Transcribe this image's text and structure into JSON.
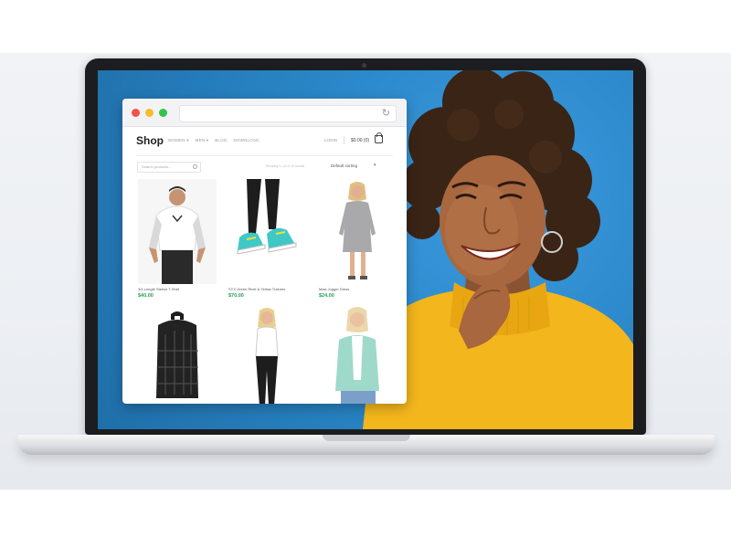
{
  "shop": {
    "logo": "Shop",
    "nav": [
      "WOMEN ▾",
      "MEN ▾",
      "BLOG",
      "DOWNLOAD"
    ],
    "login": "LOGIN",
    "cart_total": "$0.00 (0)",
    "search_placeholder": "Search products...",
    "result_count": "Showing 1–12 of 16 results",
    "sort_label": "Default sorting"
  },
  "products": [
    {
      "name": "3/4 Length Sleeve T-Shirt",
      "price": "$40.00"
    },
    {
      "name": "SYX Green Rivet & Yellow Trainers",
      "price": "$70.00"
    },
    {
      "name": "Maxi Jogger Dress",
      "price": "$24.00"
    },
    {
      "name": "",
      "price": ""
    },
    {
      "name": "",
      "price": ""
    },
    {
      "name": "",
      "price": ""
    }
  ],
  "icons": {
    "reload": "reload-icon",
    "cart": "cart-icon",
    "search": "search-icon",
    "dropdown": "chevron-down-icon"
  },
  "colors": {
    "screen_bg": "#2a86c7",
    "price_green": "#27a05a",
    "sweater_yellow": "#f3b61c",
    "dot_red": "#f1524a",
    "dot_yellow": "#f6bc2d",
    "dot_green": "#34c44a"
  }
}
